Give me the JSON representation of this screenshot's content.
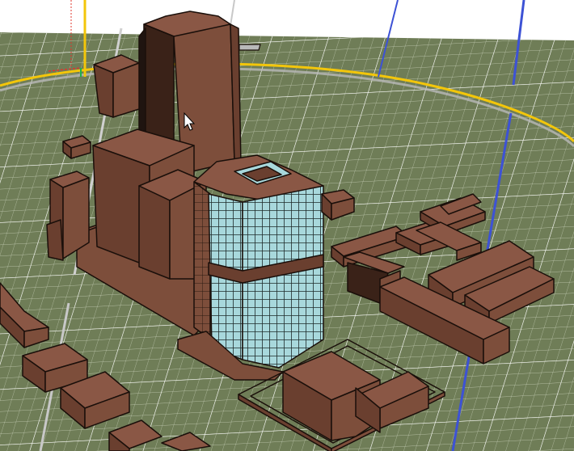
{
  "viewport": {
    "colors": {
      "sky": "#ffffff",
      "ground": "#6f7d57",
      "grid_minor": "#e7ecd9",
      "grid_major": "#ffffff",
      "building_face_front": "#7d4e3b",
      "building_face_side": "#6a3f2f",
      "building_face_top": "#8a5745",
      "building_outline": "#1a0f0a",
      "glass": "#a8d8dc",
      "glass_frame": "#1e2a2a",
      "axis_x": "#e0342b",
      "axis_y": "#1fb04b",
      "axis_z": "#3d52d5",
      "boundary_line": "#f3c60a",
      "guide_line": "#b9b9b9"
    },
    "cursor_icon": "arrow-cursor-icon"
  }
}
